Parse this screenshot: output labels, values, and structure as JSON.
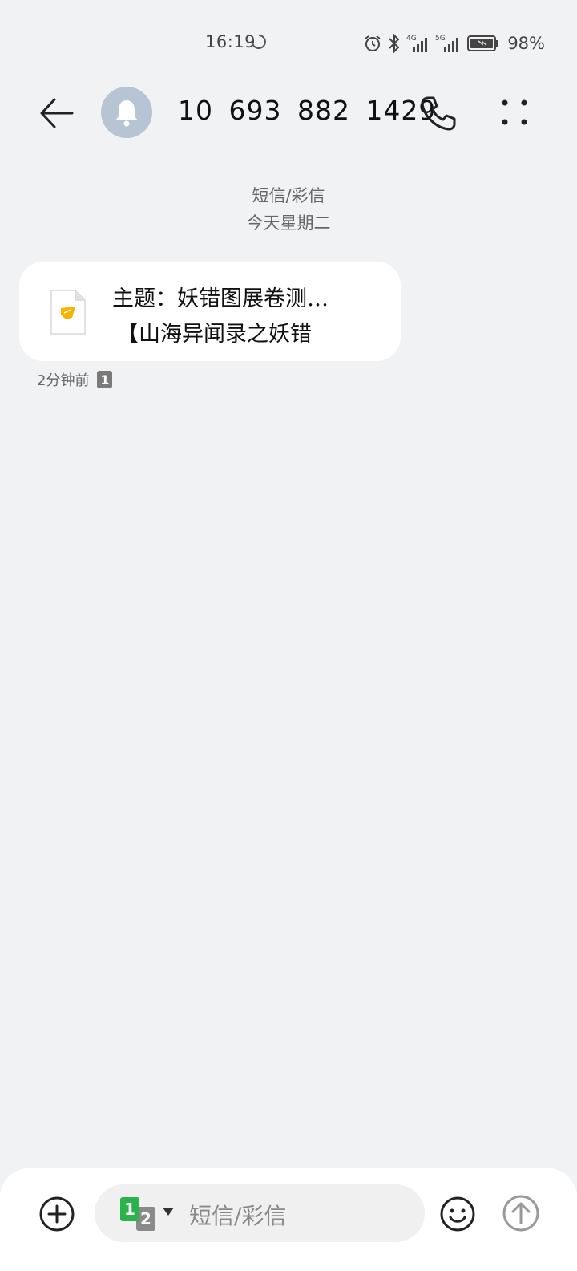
{
  "status_bar": {
    "time": "16:19",
    "network_1": "4G",
    "network_2": "5G",
    "battery": "98%"
  },
  "header": {
    "contact_number": "10 693 882 1429",
    "icons": [
      "back-arrow-icon",
      "bell-icon",
      "phone-icon",
      "more-dots-icon"
    ]
  },
  "conversation": {
    "message_type": "短信/彩信",
    "date_label": "今天星期二",
    "messages": [
      {
        "subject_line": "主题：妖错图展卷测…",
        "preview_line": "【山海异闻录之妖错",
        "time": "2分钟前",
        "sim": "1"
      }
    ]
  },
  "composer": {
    "sim_primary": "1",
    "sim_secondary": "2",
    "placeholder": "短信/彩信",
    "icons": [
      "add-circle-icon",
      "emoji-icon",
      "send-arrow-icon"
    ]
  },
  "colors": {
    "background": "#f1f2f4",
    "bubble": "#ffffff",
    "avatar": "#b6c4d3",
    "sim1": "#2ab34a",
    "file_accent": "#f5b400"
  }
}
